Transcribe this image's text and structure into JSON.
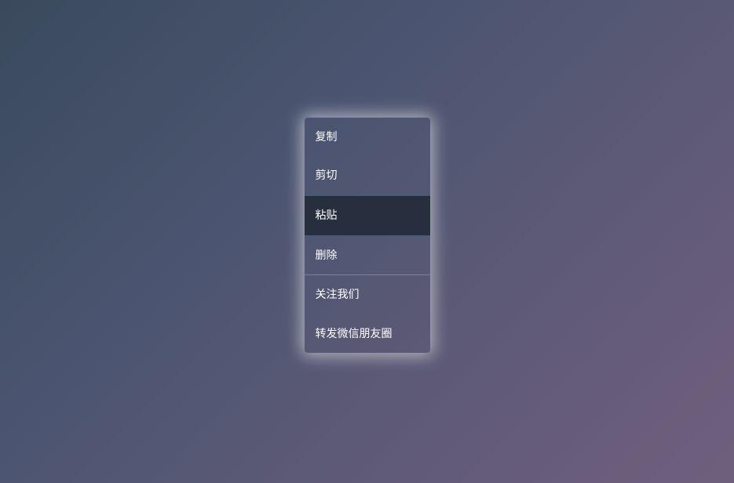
{
  "menu": {
    "groups": [
      {
        "items": [
          {
            "id": "copy",
            "label": "复制",
            "active": false
          },
          {
            "id": "cut",
            "label": "剪切",
            "active": false
          },
          {
            "id": "paste",
            "label": "粘贴",
            "active": true
          },
          {
            "id": "delete",
            "label": "删除",
            "active": false
          }
        ]
      },
      {
        "items": [
          {
            "id": "follow-us",
            "label": "关注我们",
            "active": false
          },
          {
            "id": "share-wechat",
            "label": "转发微信朋友圈",
            "active": false
          }
        ]
      }
    ]
  }
}
